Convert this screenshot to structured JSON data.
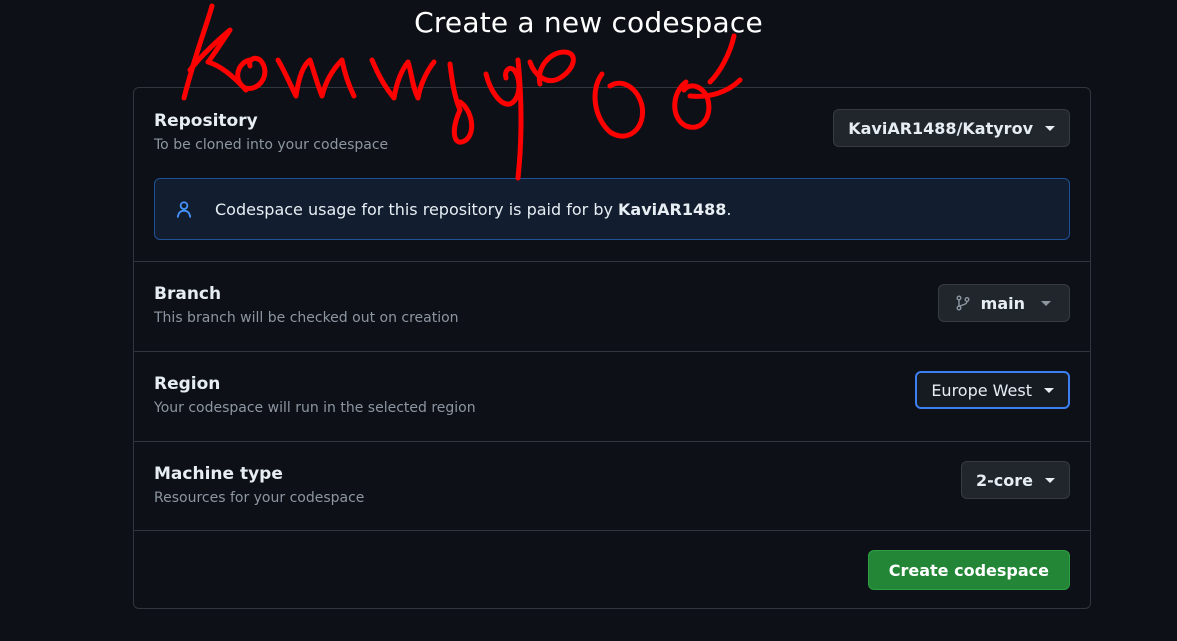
{
  "page": {
    "title": "Create a new codespace"
  },
  "repository": {
    "label": "Repository",
    "description": "To be cloned into your codespace",
    "selected": "KaviAR1488/Katyrov",
    "notice": {
      "text_before": "Codespace usage for this repository is paid for by ",
      "payer": "KaviAR1488",
      "text_after": ".",
      "icon": "person-icon"
    }
  },
  "branch": {
    "label": "Branch",
    "description": "This branch will be checked out on creation",
    "selected": "main",
    "icon": "git-branch-icon"
  },
  "region": {
    "label": "Region",
    "description": "Your codespace will run in the selected region",
    "selected": "Europe West"
  },
  "machine": {
    "label": "Machine type",
    "description": "Resources for your codespace",
    "selected": "2-core"
  },
  "footer": {
    "create_label": "Create codespace"
  },
  "overlay": {
    "description": "red handwritten scribble annotation",
    "color": "#ff0000"
  },
  "colors": {
    "background": "#0d1117",
    "border": "#30363d",
    "primary_button": "#238636",
    "focus_ring": "#3b7ff1",
    "notice_border": "#1f5196"
  }
}
